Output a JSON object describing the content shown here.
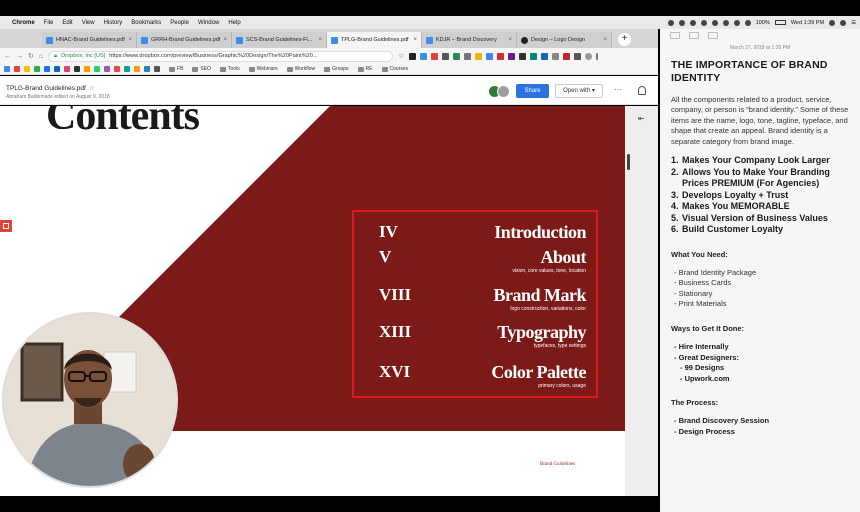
{
  "menubar": {
    "app": "Chrome",
    "items": [
      "File",
      "Edit",
      "View",
      "History",
      "Bookmarks",
      "People",
      "Window",
      "Help"
    ],
    "battery": "100%",
    "clock": "Wed 1:39 PM"
  },
  "browser": {
    "tabs": [
      {
        "label": "HNAC-Brand Guidelines.pdf",
        "color": "#3b8ee8"
      },
      {
        "label": "GRRH-Brand Guidelines.pdf",
        "color": "#3b8ee8"
      },
      {
        "label": "SCS-Brand Guidelines-Fi...",
        "color": "#3b8ee8"
      },
      {
        "label": "TPLG-Brand Guidelines.pdf",
        "color": "#3b8ee8"
      },
      {
        "label": "KDJR – Brand Discovery",
        "color": "#4a8af4"
      },
      {
        "label": "Design – Logo Design",
        "color": "#222222"
      }
    ],
    "address": {
      "org": "Dropbox, Inc [US]",
      "url": "https://www.dropbox.com/preview/Business/Graphic%20Design/The%20Paint%20..."
    },
    "bookmarks": [
      "FB",
      "SEO",
      "Tools",
      "Webinars",
      "Workflow",
      "Groups",
      "RE",
      "Courses"
    ]
  },
  "dropbox": {
    "file_title": "TPLG-Brand Guidelines.pdf",
    "subtitle": "Abraham Baldemade edited on August 9, 2018",
    "share_label": "Share",
    "open_with_label": "Open with ▾",
    "more_label": "···",
    "collapse_label": "⇤"
  },
  "pdf": {
    "heading": "Contents",
    "brand_color": "#7b1a17",
    "box_color": "#e2151b",
    "toc": [
      {
        "num": "IV",
        "title": "Introduction",
        "sub": ""
      },
      {
        "num": "V",
        "title": "About",
        "sub": "vision, core values, tone, location"
      },
      {
        "num": "VIII",
        "title": "Brand Mark",
        "sub": "logo construction, variations, color"
      },
      {
        "num": "XIII",
        "title": "Typography",
        "sub": "typefaces, type settings"
      },
      {
        "num": "XVI",
        "title": "Color Palette",
        "sub": "primary colors, usage"
      }
    ],
    "footer": "Brand Guidelines"
  },
  "notes": {
    "date": "March 27, 2018 at 1:35 PM",
    "title": "THE IMPORTANCE OF BRAND IDENTITY",
    "paragraph": "All the components related to a product, service, company, or person is “brand identity.” Some of these items are the name, logo, tone, tagline, typeface, and shape that create an appeal. Brand identity is a separate category from brand image.",
    "benefits": [
      "Makes Your Company Look Larger",
      "Allows You to Make Your Branding Prices PREMIUM (For Agencies)",
      "Develops Loyalty + Trust",
      "Makes You MEMORABLE",
      "Visual Version of Business Values",
      "Build Customer Loyalty"
    ],
    "need_title": "What You Need:",
    "need_items": [
      "Brand Identity Package",
      "Business Cards",
      "Stationary",
      "Print Materials"
    ],
    "ways_title": "Ways to Get It Done:",
    "ways_items": [
      "Hire Internally",
      "Great Designers:",
      "99 Designs",
      "Upwork.com"
    ],
    "process_title": "The Process:",
    "process_items": [
      "Brand Discovery Session",
      "Design Process"
    ]
  }
}
